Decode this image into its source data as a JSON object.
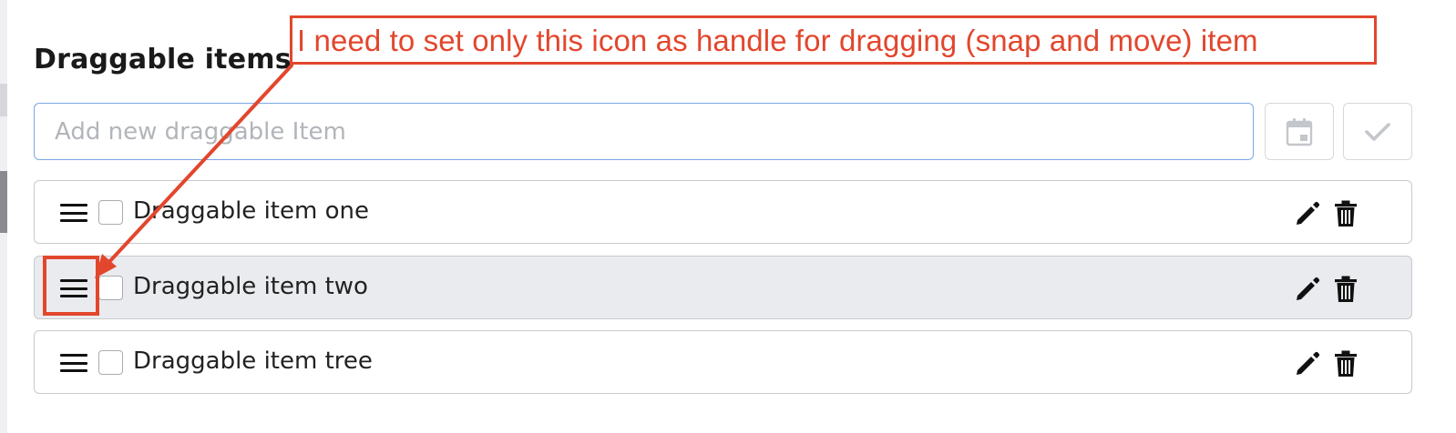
{
  "panel": {
    "title": "Draggable items",
    "new_item": {
      "value": "",
      "placeholder": "Add new draggable Item"
    },
    "buttons": {
      "date_icon": "calendar-icon",
      "confirm_icon": "checkmark-icon"
    }
  },
  "items": [
    {
      "label": "Draggable item one",
      "checked": false,
      "highlighted": false
    },
    {
      "label": "Draggable item two",
      "checked": false,
      "highlighted": true
    },
    {
      "label": "Draggable item tree",
      "checked": false,
      "highlighted": false
    }
  ],
  "row_icons": {
    "handle": "drag-handle-icon",
    "edit": "pencil-icon",
    "delete": "trash-icon"
  },
  "annotation": {
    "text": "I need to set only this icon as handle for dragging (snap and move) item",
    "color": "#e2462d"
  },
  "colors": {
    "input_focus_border": "#7aa8e6",
    "row_highlight": "#eaebee",
    "row_border": "#c8cacd"
  }
}
